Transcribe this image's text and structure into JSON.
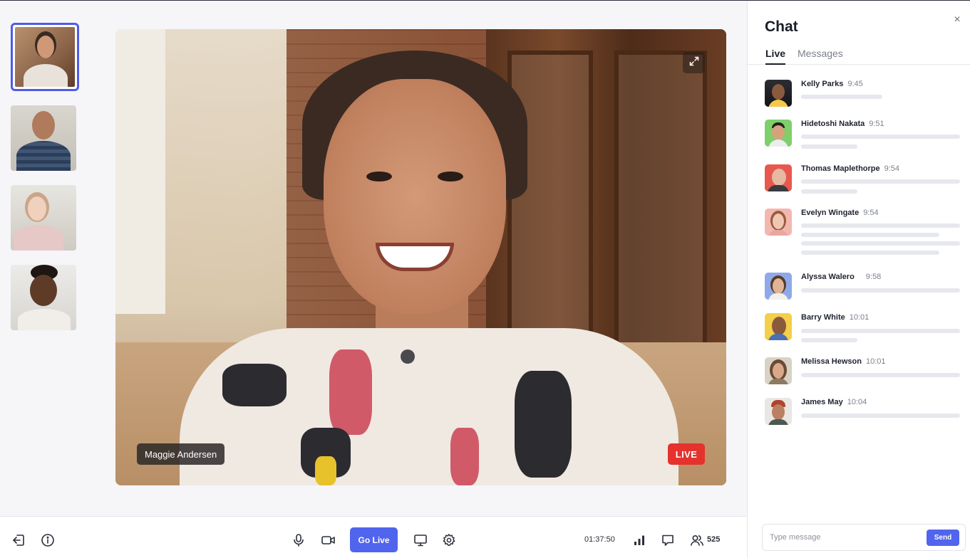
{
  "stage": {
    "speaker_name": "Maggie Andersen",
    "live_label": "LIVE",
    "thumbnails": [
      {
        "person": "participant-1",
        "active": true
      },
      {
        "person": "participant-2",
        "active": false
      },
      {
        "person": "participant-3",
        "active": false
      },
      {
        "person": "participant-4",
        "active": false
      }
    ]
  },
  "toolbar": {
    "leave_icon": "leave-icon",
    "info_icon": "info-icon",
    "mic_icon": "microphone-icon",
    "camera_icon": "video-camera-icon",
    "go_live_label": "Go Live",
    "screen_icon": "screen-share-icon",
    "settings_icon": "gear-icon",
    "timer": "01:37:50",
    "signal_icon": "signal-bars-icon",
    "chat_icon": "chat-bubble-icon",
    "people_icon": "people-icon",
    "participant_count": "525"
  },
  "chat": {
    "title": "Chat",
    "close_label": "×",
    "tabs": [
      {
        "label": "Live",
        "active": true
      },
      {
        "label": "Messages",
        "active": false
      }
    ],
    "messages": [
      {
        "name": "Kelly Parks",
        "time": "9:45"
      },
      {
        "name": "Hidetoshi Nakata",
        "time": "9:51"
      },
      {
        "name": "Thomas Maplethorpe",
        "time": "9:54"
      },
      {
        "name": "Evelyn Wingate",
        "time": "9:54"
      },
      {
        "name": "Alyssa Walero",
        "time": "9:58"
      },
      {
        "name": "Barry White",
        "time": "10:01"
      },
      {
        "name": "Melissa Hewson",
        "time": "10:01"
      },
      {
        "name": "James May",
        "time": "10:04"
      }
    ],
    "composer": {
      "placeholder": "Type message",
      "send_label": "Send"
    }
  },
  "colors": {
    "accent": "#5164ee",
    "live_red": "#e5322d",
    "active_border": "#4f5be6"
  }
}
